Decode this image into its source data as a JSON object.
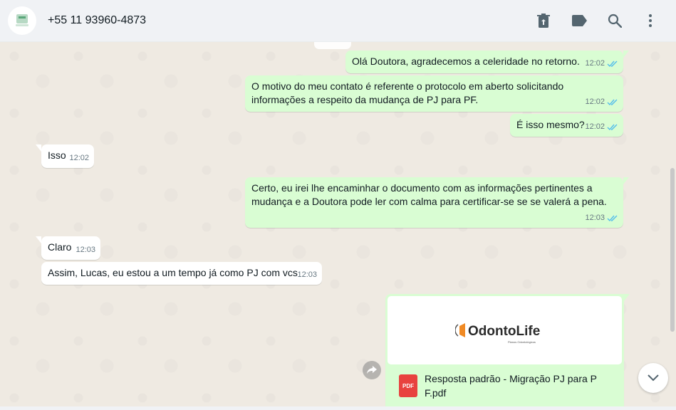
{
  "header": {
    "contact": "+55 11 93960-4873",
    "icons": [
      "delete-icon",
      "label-icon",
      "search-icon",
      "menu-icon"
    ]
  },
  "messages": [
    {
      "dir": "out",
      "text": "Olá Doutora, agradecemos a celeridade no retorno.",
      "time": "12:02",
      "status": "read"
    },
    {
      "dir": "out",
      "text": "O motivo do meu contato é referente o protocolo em aberto solicitando\ninformações a respeito da mudança de PJ para PF.",
      "time": "12:02",
      "status": "read"
    },
    {
      "dir": "out",
      "text": "É isso mesmo?",
      "time": "12:02",
      "status": "read"
    },
    {
      "dir": "in",
      "text": "Isso",
      "time": "12:02"
    },
    {
      "dir": "out",
      "text": "Certo, eu irei lhe encaminhar o documento com as informações pertinentes a\nmudança e a Doutora pode ler com calma para certificar-se se se valerá a pena.",
      "time": "12:03",
      "status": "read"
    },
    {
      "dir": "in",
      "text": "Claro",
      "time": "12:03"
    },
    {
      "dir": "in",
      "text": "Assim, Lucas, eu estou a um tempo já como PJ com vcs",
      "time": "12:03"
    }
  ],
  "document": {
    "brand": "OdontoLife",
    "brand_tagline": "Planos Odontológicos",
    "file_type": "PDF",
    "file_name": "Resposta padrão - Migração PJ para P\nF.pdf"
  },
  "colors": {
    "outgoing": "#d9fdd3",
    "incoming": "#ffffff",
    "read_ticks": "#53bdeb",
    "pdf": "#e8423f"
  }
}
